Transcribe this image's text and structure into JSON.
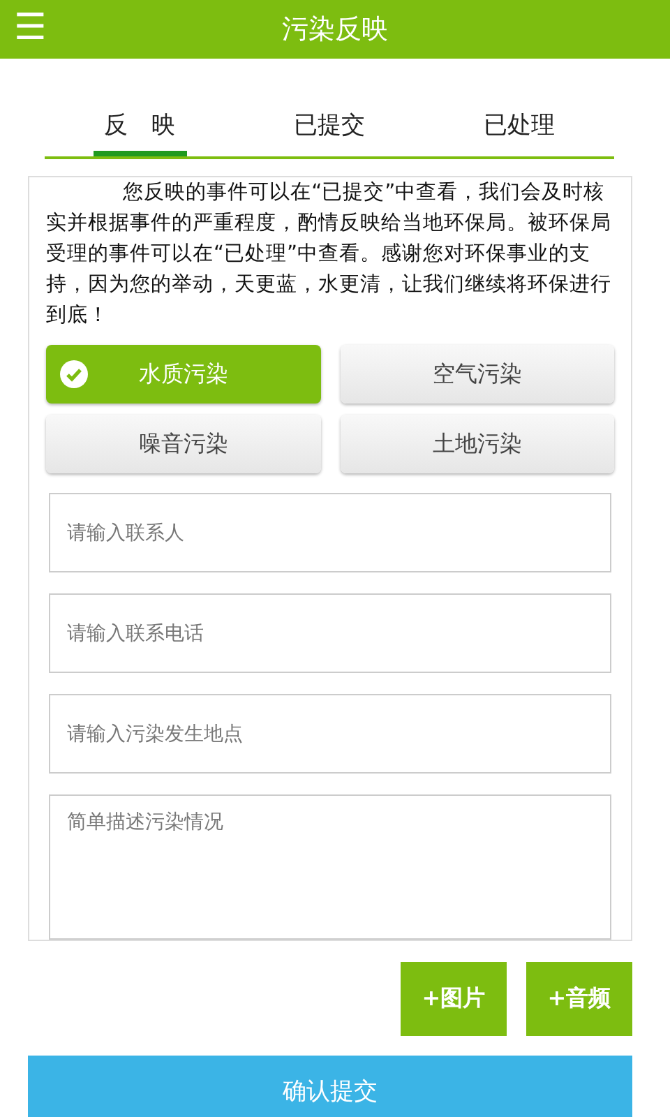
{
  "header": {
    "menu_icon": "☰",
    "title": "污染反映"
  },
  "tabs": [
    {
      "label": "反　映",
      "selected": true
    },
    {
      "label": "已提交",
      "selected": false
    },
    {
      "label": "已处理",
      "selected": false
    }
  ],
  "intro": "您反映的事件可以在“已提交”中查看，我们会及时核实并根据事件的严重程度，酌情反映给当地环保局。被环保局受理的事件可以在“已处理”中查看。感谢您对环保事业的支持，因为您的举动，天更蓝，水更清，让我们继续将环保进行到底！",
  "pollution_types": [
    {
      "label": "水质污染",
      "selected": true
    },
    {
      "label": "空气污染",
      "selected": false
    },
    {
      "label": "噪音污染",
      "selected": false
    },
    {
      "label": "土地污染",
      "selected": false
    }
  ],
  "fields": [
    {
      "kind": "input",
      "placeholder": "请输入联系人"
    },
    {
      "kind": "input",
      "placeholder": "请输入联系电话"
    },
    {
      "kind": "input",
      "placeholder": "请输入污染发生地点"
    },
    {
      "kind": "textarea",
      "placeholder": "简单描述污染情况"
    }
  ],
  "attach_buttons": [
    "+图片",
    "+音频"
  ],
  "submit": "确认提交"
}
